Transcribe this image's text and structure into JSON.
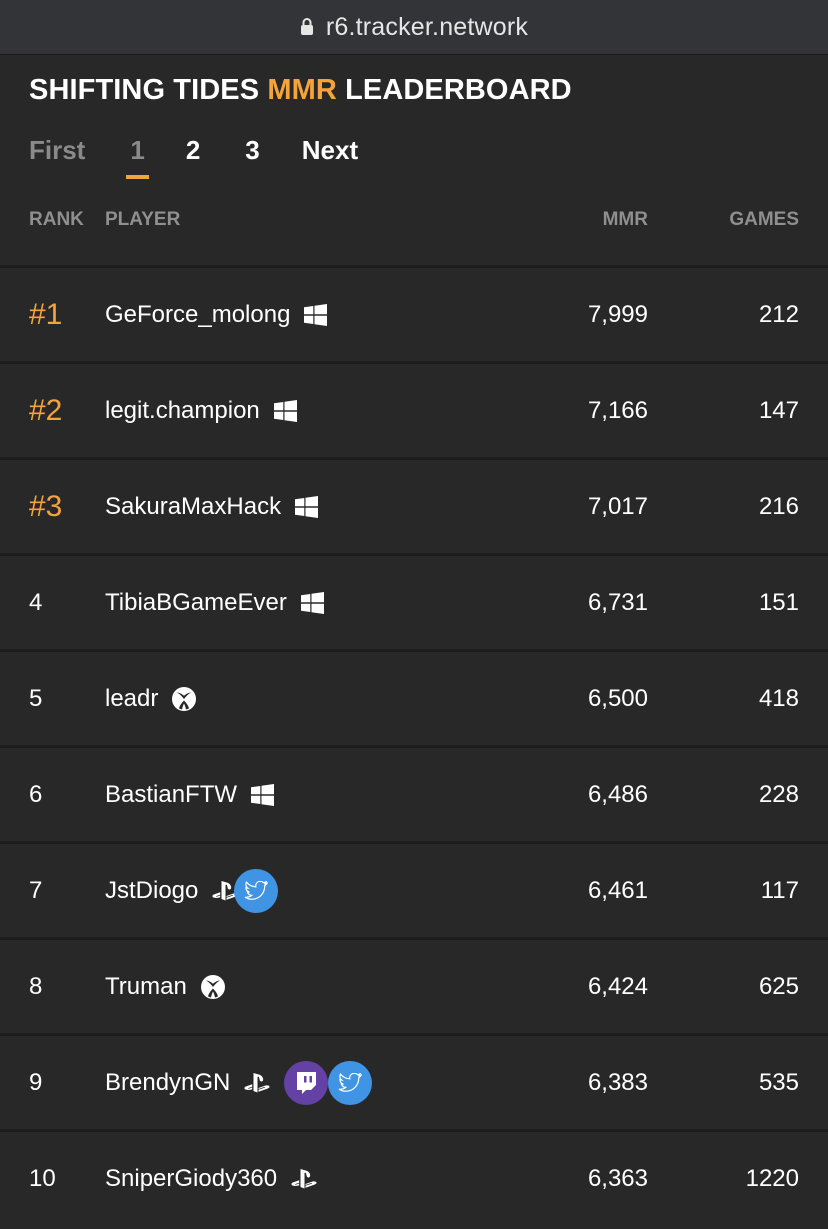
{
  "browser": {
    "url": "r6.tracker.network"
  },
  "header": {
    "title_prefix": "SHIFTING TIDES ",
    "title_accent": "MMR",
    "title_suffix": " LEADERBOARD"
  },
  "pagination": {
    "first": "First",
    "pages": [
      "1",
      "2",
      "3"
    ],
    "active_page": "1",
    "next": "Next"
  },
  "table": {
    "columns": {
      "rank": "RANK",
      "player": "PLAYER",
      "mmr": "MMR",
      "games": "GAMES"
    },
    "rows": [
      {
        "rank": "#1",
        "name": "GeForce_molong",
        "platform": "windows-icon",
        "socials": [],
        "mmr": "7,999",
        "games": "212"
      },
      {
        "rank": "#2",
        "name": "legit.champion",
        "platform": "windows-icon",
        "socials": [],
        "mmr": "7,166",
        "games": "147"
      },
      {
        "rank": "#3",
        "name": "SakuraMaxHack",
        "platform": "windows-icon",
        "socials": [],
        "mmr": "7,017",
        "games": "216"
      },
      {
        "rank": "4",
        "name": "TibiaBGameEver",
        "platform": "windows-icon",
        "socials": [],
        "mmr": "6,731",
        "games": "151"
      },
      {
        "rank": "5",
        "name": "leadr",
        "platform": "xbox-icon",
        "socials": [],
        "mmr": "6,500",
        "games": "418"
      },
      {
        "rank": "6",
        "name": "BastianFTW",
        "platform": "windows-icon",
        "socials": [],
        "mmr": "6,486",
        "games": "228"
      },
      {
        "rank": "7",
        "name": "JstDiogo",
        "platform": "playstation-icon",
        "socials": [
          "twitter-icon"
        ],
        "mmr": "6,461",
        "games": "117"
      },
      {
        "rank": "8",
        "name": "Truman",
        "platform": "xbox-icon",
        "socials": [],
        "mmr": "6,424",
        "games": "625"
      },
      {
        "rank": "9",
        "name": "BrendynGN",
        "platform": "playstation-icon",
        "socials": [
          "twitch-icon",
          "twitter-icon"
        ],
        "mmr": "6,383",
        "games": "535"
      },
      {
        "rank": "10",
        "name": "SniperGiody360",
        "platform": "playstation-icon",
        "socials": [],
        "mmr": "6,363",
        "games": "1220"
      }
    ]
  },
  "colors": {
    "accent": "#f4a43a",
    "background": "#282828",
    "twitch": "#6441a4",
    "twitter": "#3f94e3"
  }
}
